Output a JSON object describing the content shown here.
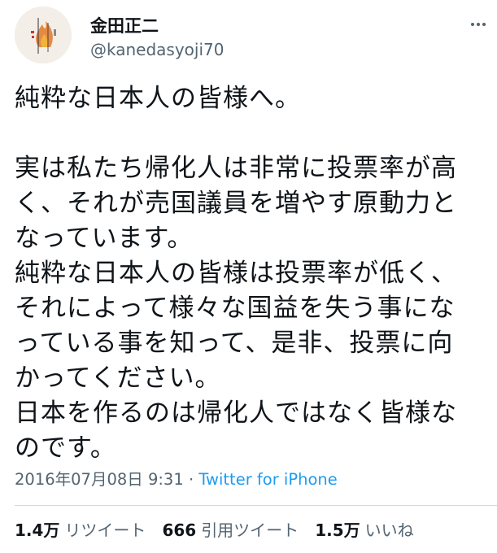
{
  "author": {
    "name": "金田正二",
    "handle": "@kanedasyoji70",
    "avatar_icon": "book-cover-avatar"
  },
  "tweet": {
    "text": "純粋な日本人の皆様へ。\n\n実は私たち帰化人は非常に投票率が高\nく、それが売国議員を増やす原動力と\nなっています。\n純粋な日本人の皆様は投票率が低く、\nそれによって様々な国益を失う事にな\nっている事を知って、是非、投票に向\nかってください。\n日本を作るのは帰化人ではなく皆様な\nのです。"
  },
  "meta": {
    "timestamp": "2016年07月08日 9:31",
    "separator": "·",
    "source": "Twitter for iPhone"
  },
  "stats": {
    "retweets_count": "1.4万",
    "retweets_label": "リツイート",
    "quotes_count": "666",
    "quotes_label": "引用ツイート",
    "likes_count": "1.5万",
    "likes_label": "いいね"
  },
  "colors": {
    "text": "#0f1419",
    "secondary": "#536471",
    "link": "#1d9bf0",
    "divider": "#cfd9de"
  }
}
